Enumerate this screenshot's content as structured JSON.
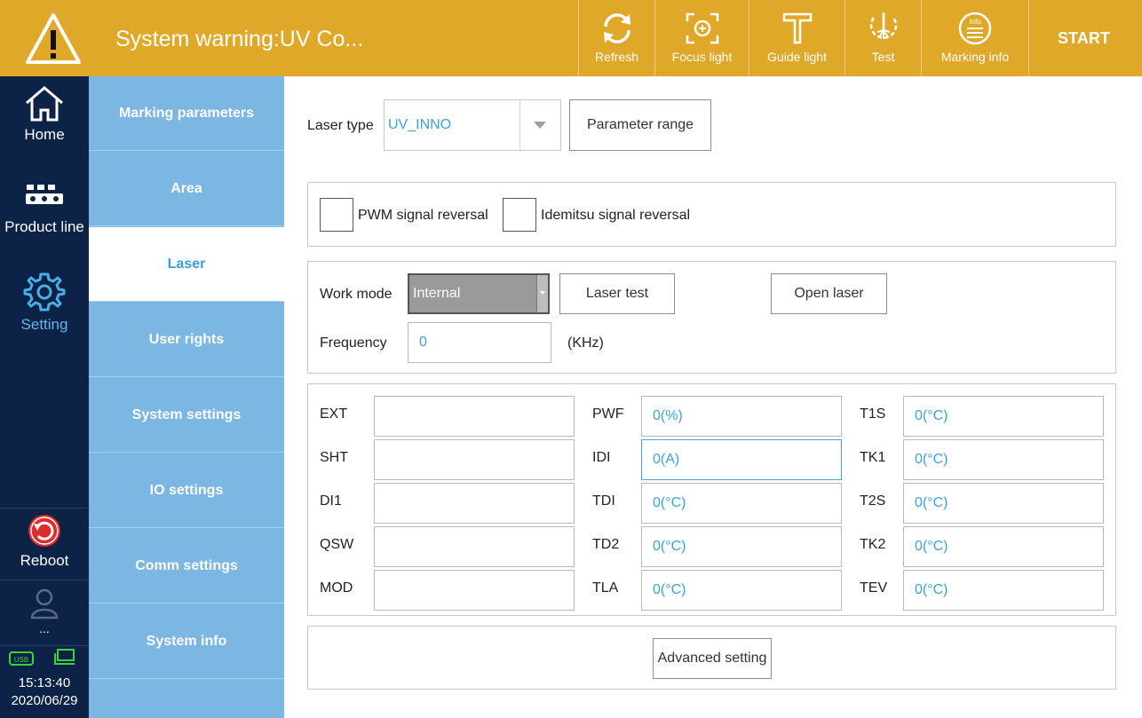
{
  "header": {
    "warning_title": "System warning:UV Co...",
    "tools": [
      {
        "label": "Refresh",
        "icon": "refresh-icon"
      },
      {
        "label": "Focus light",
        "icon": "focus-light-icon"
      },
      {
        "label": "Guide light",
        "icon": "guide-light-icon"
      },
      {
        "label": "Test",
        "icon": "test-icon"
      },
      {
        "label": "Marking info",
        "icon": "marking-info-icon"
      }
    ],
    "start_label": "START",
    "accent_color": "#e0a829"
  },
  "leftnav": {
    "items": [
      {
        "label": "Home",
        "icon": "home-icon"
      },
      {
        "label": "Product line",
        "icon": "product-line-icon"
      },
      {
        "label": "Setting",
        "icon": "gear-icon",
        "active": true
      },
      {
        "label": "Reboot",
        "icon": "reboot-icon"
      }
    ],
    "user_label": "...",
    "time": "15:13:40",
    "date": "2020/06/29"
  },
  "subnav": {
    "items": [
      {
        "label": "Marking parameters"
      },
      {
        "label": "Area"
      },
      {
        "label": "Laser",
        "active": true
      },
      {
        "label": "User rights"
      },
      {
        "label": "System settings"
      },
      {
        "label": "IO settings"
      },
      {
        "label": "Comm settings"
      },
      {
        "label": "System info"
      }
    ]
  },
  "laser": {
    "laser_type_label": "Laser type",
    "laser_type_value": "UV_INNO",
    "param_range_label": "Parameter range",
    "pwm_reversal_label": "PWM signal reversal",
    "idemitsu_reversal_label": "Idemitsu signal reversal",
    "work_mode_label": "Work mode",
    "work_mode_value": "Internal",
    "laser_test_label": "Laser test",
    "open_laser_label": "Open laser",
    "frequency_label": "Frequency",
    "frequency_value": "0",
    "frequency_unit": "(KHz)",
    "status_col1": [
      {
        "label": "EXT",
        "value": ""
      },
      {
        "label": "SHT",
        "value": ""
      },
      {
        "label": "DI1",
        "value": ""
      },
      {
        "label": "QSW",
        "value": ""
      },
      {
        "label": "MOD",
        "value": ""
      }
    ],
    "status_col2": [
      {
        "label": "PWF",
        "value": "0(%)"
      },
      {
        "label": "IDI",
        "value": "0(A)"
      },
      {
        "label": "TDI",
        "value": "0(°C)"
      },
      {
        "label": "TD2",
        "value": "0(°C)"
      },
      {
        "label": "TLA",
        "value": "0(°C)"
      }
    ],
    "status_col3": [
      {
        "label": "T1S",
        "value": "0(°C)"
      },
      {
        "label": "TK1",
        "value": "0(°C)"
      },
      {
        "label": "T2S",
        "value": "0(°C)"
      },
      {
        "label": "TK2",
        "value": "0(°C)"
      },
      {
        "label": "TEV",
        "value": "0(°C)"
      }
    ],
    "advanced_label": "Advanced setting"
  }
}
